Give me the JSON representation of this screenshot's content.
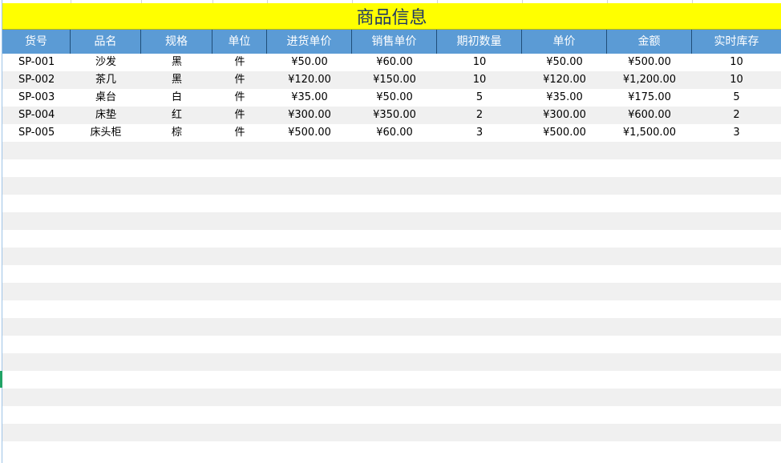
{
  "sheet": {
    "title": "商品信息",
    "columns": [
      "货号",
      "品名",
      "规格",
      "单位",
      "进货单价",
      "销售单价",
      "期初数量",
      "单价",
      "金额",
      "实时库存"
    ],
    "rows": [
      [
        "SP-001",
        "沙发",
        "黑",
        "件",
        "¥50.00",
        "¥60.00",
        "10",
        "¥50.00",
        "¥500.00",
        "10"
      ],
      [
        "SP-002",
        "茶几",
        "黑",
        "件",
        "¥120.00",
        "¥150.00",
        "10",
        "¥120.00",
        "¥1,200.00",
        "10"
      ],
      [
        "SP-003",
        "桌台",
        "白",
        "件",
        "¥35.00",
        "¥50.00",
        "5",
        "¥35.00",
        "¥175.00",
        "5"
      ],
      [
        "SP-004",
        "床垫",
        "红",
        "件",
        "¥300.00",
        "¥350.00",
        "2",
        "¥300.00",
        "¥600.00",
        "2"
      ],
      [
        "SP-005",
        "床头柜",
        "棕",
        "件",
        "¥500.00",
        "¥60.00",
        "3",
        "¥500.00",
        "¥1,500.00",
        "3"
      ]
    ]
  },
  "colors": {
    "title_bg": "#ffff00",
    "title_text": "#1f3864",
    "header_bg": "#5b9bd5",
    "header_text": "#ffffff",
    "stripe": "#f0f0f0",
    "selection": "#21a366"
  }
}
